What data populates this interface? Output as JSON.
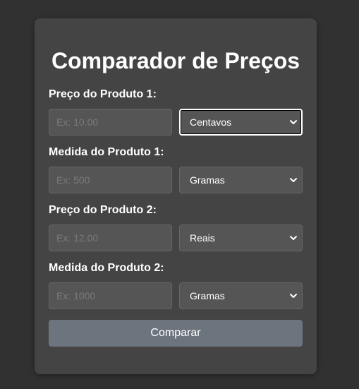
{
  "page": {
    "title": "Comparador de Preços"
  },
  "form": {
    "fields": [
      {
        "label": "Preço do Produto 1:",
        "placeholder": "Ex: 10.00",
        "unit": "Centavos"
      },
      {
        "label": "Medida do Produto 1:",
        "placeholder": "Ex: 500",
        "unit": "Gramas"
      },
      {
        "label": "Preço do Produto 2:",
        "placeholder": "Ex: 12.00",
        "unit": "Reais"
      },
      {
        "label": "Medida do Produto 2:",
        "placeholder": "Ex: 1000",
        "unit": "Gramas"
      }
    ],
    "submit_label": "Comparar"
  },
  "colors": {
    "background": "#313131",
    "card": "#444444",
    "input": "#555555",
    "button": "#6c757d",
    "text": "#ffffff"
  },
  "icons": {
    "select_arrow": "chevron-down-icon"
  }
}
